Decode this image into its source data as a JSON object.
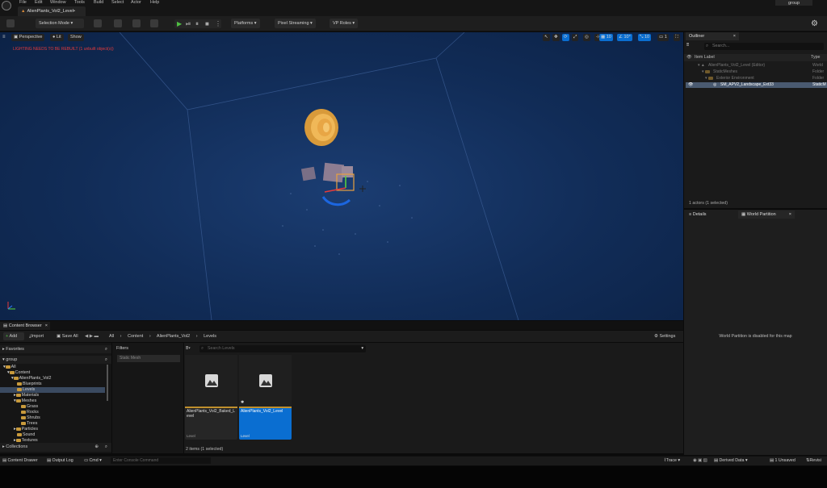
{
  "menu": [
    "File",
    "Edit",
    "Window",
    "Tools",
    "Build",
    "Select",
    "Actor",
    "Help"
  ],
  "top_right_tab": "group",
  "level_tab": "AlienPlants_Vol2_Level•",
  "toolbar": {
    "selection_mode": "Selection Mode",
    "platforms": "Platforms",
    "pixel_streaming": "Pixel Streaming",
    "vp_roles": "VP Roles"
  },
  "viewport": {
    "perspective": "Perspective",
    "lit": "Lit",
    "show": "Show",
    "warning": "LIGHTING NEEDS TO BE REBUILT (1 unbuilt object(s))",
    "grid_size": "10",
    "rotation_snap": "10°",
    "scale_snap": "10",
    "camera_speed": "1"
  },
  "outliner": {
    "tab": "Outliner",
    "search_placeholder": "Search...",
    "col_label": "Item Label",
    "col_type": "Type",
    "rows": [
      {
        "label": "AlienPlants_Vol2_Level (Editor)",
        "type": "World"
      },
      {
        "label": "StaticMeshes",
        "type": "Folder"
      },
      {
        "label": "Exterior Environment",
        "type": "Folder"
      },
      {
        "label": "SM_APV2_Landscape_Ext33",
        "type": "StaticM"
      }
    ],
    "status": "1 actors (1 selected)"
  },
  "details": {
    "tab_details": "Details",
    "tab_world_partition": "World Partition",
    "message": "World Partition is disabled for this map"
  },
  "content_browser": {
    "tab": "Content Browser",
    "add": "Add",
    "import": "Import",
    "save_all": "Save All",
    "breadcrumb": [
      "All",
      "Content",
      "AlienPlants_Vol2",
      "Levels"
    ],
    "settings": "Settings",
    "favorites": "Favorites",
    "group": "group",
    "filters": "Filters",
    "filter_chip": "Static Mesh",
    "search_placeholder": "Search Levels",
    "collections": "Collections",
    "tree": [
      "All",
      "Content",
      "AlienPlants_Vol2",
      "Blueprints",
      "Levels",
      "Materials",
      "Meshes",
      "Grass",
      "Rocks",
      "Shrubs",
      "Trees",
      "Particles",
      "Sound",
      "Textures"
    ],
    "assets": [
      {
        "name": "AlienPlants_Vol2_Baked_Level",
        "type": "Level"
      },
      {
        "name": "AlienPlants_Vol2_Level",
        "type": "Level"
      }
    ],
    "item_count": "2 items (1 selected)"
  },
  "statusbar": {
    "content_drawer": "Content Drawer",
    "output_log": "Output Log",
    "cmd": "Cmd",
    "console_placeholder": "Enter Console Command",
    "trace": "Trace",
    "derived_data": "Derived Data",
    "unsaved": "1 Unsaved",
    "revision": "Revisi"
  },
  "colors": {
    "accent_blue": "#0a6ed1",
    "warning_red": "#e53b3b",
    "folder_gold": "#c89a3c",
    "viewport_blue": "#153468"
  }
}
